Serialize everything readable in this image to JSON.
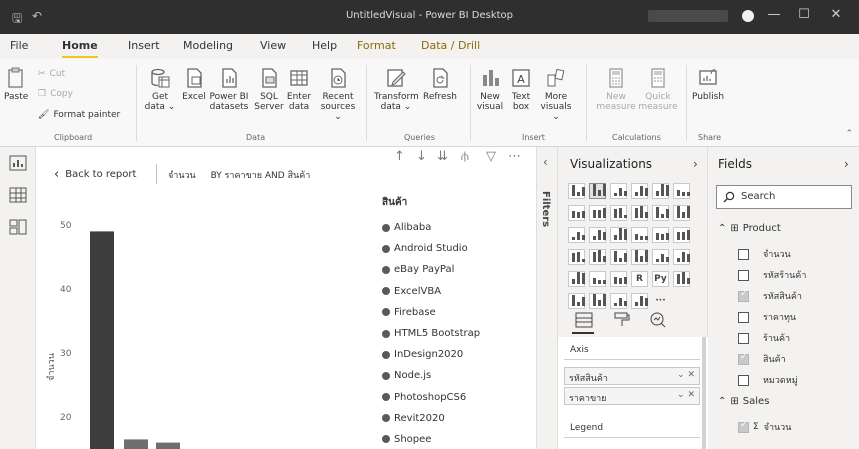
{
  "titlebar": {
    "title": "UntitledVisual - Power BI Desktop",
    "save_icon": "save-icon",
    "undo_icon": "undo-icon",
    "window_buttons": [
      "minimize-icon",
      "restore-icon",
      "close-icon"
    ]
  },
  "ribbon_tabs": [
    {
      "label": "File",
      "active": false
    },
    {
      "label": "Home",
      "active": true
    },
    {
      "label": "Insert",
      "active": false
    },
    {
      "label": "Modeling",
      "active": false
    },
    {
      "label": "View",
      "active": false
    },
    {
      "label": "Help",
      "active": false
    },
    {
      "label": "Format",
      "active": false
    },
    {
      "label": "Data / Drill",
      "active": false
    }
  ],
  "ribbon": {
    "clipboard": {
      "paste": "Paste",
      "cut": "Cut",
      "copy": "Copy",
      "format_painter": "Format painter",
      "label": "Clipboard"
    },
    "data": {
      "get_data": "Get data ⌄",
      "excel": "Excel",
      "power_bi": "Power BI datasets",
      "sql": "SQL Server",
      "enter_data": "Enter data",
      "recent": "Recent sources ⌄",
      "label": "Data"
    },
    "queries": {
      "transform": "Transform data ⌄",
      "refresh": "Refresh",
      "label": "Queries"
    },
    "insert": {
      "new_visual": "New visual",
      "text_box": "Text box",
      "more_visuals": "More visuals ⌄",
      "label": "Insert"
    },
    "calculations": {
      "new_measure": "New measure",
      "quick_measure": "Quick measure",
      "label": "Calculations"
    },
    "share": {
      "publish": "Publish",
      "label": "Share"
    }
  },
  "canvas": {
    "back_label": "Back to report",
    "breadcrumb": [
      "จำนวน",
      "BY ราคาขาย AND สินค้า"
    ]
  },
  "chart_data": {
    "type": "bar",
    "ylabel": "จำนวน",
    "y_ticks": [
      20,
      30,
      40,
      50
    ],
    "ylim": [
      15,
      55
    ],
    "legend_title": "สินค้า",
    "legend_placement": "right",
    "legend": [
      "Alibaba",
      "Android Studio",
      "eBay PayPal",
      "ExcelVBA",
      "Firebase",
      "HTML5 Bootstrap",
      "InDesign2020",
      "Node.js",
      "PhotoshopCS6",
      "Revit2020",
      "Shopee"
    ],
    "values": [
      49,
      16.5,
      16
    ],
    "bar_colors": [
      "#3d3d3d",
      "#6e6e6e",
      "#6e6e6e"
    ],
    "gridlines": false
  },
  "filters": {
    "label": "Filters"
  },
  "visualizations": {
    "title": "Visualizations",
    "axis_label": "Axis",
    "axis_fields": [
      "รหัสสินค้า",
      "ราคาขาย"
    ],
    "legend_label": "Legend"
  },
  "fields": {
    "title": "Fields",
    "search_placeholder": "Search",
    "tables": [
      {
        "name": "Product",
        "fields": [
          {
            "name": "จำนวน",
            "checked": false
          },
          {
            "name": "รหัสร้านค้า",
            "checked": false
          },
          {
            "name": "รหัสสินค้า",
            "checked": true
          },
          {
            "name": "ราคาทุน",
            "checked": false
          },
          {
            "name": "ร้านค้า",
            "checked": false
          },
          {
            "name": "สินค้า",
            "checked": true
          },
          {
            "name": "หมวดหมู่",
            "checked": false
          }
        ]
      },
      {
        "name": "Sales",
        "fields": [
          {
            "name": "จำนวน",
            "checked": true,
            "sigma": true
          }
        ]
      }
    ]
  },
  "colors": {
    "accent": "#f2c811",
    "titlebar": "#2f2f2f",
    "ribbon": "#f8f8f8"
  }
}
